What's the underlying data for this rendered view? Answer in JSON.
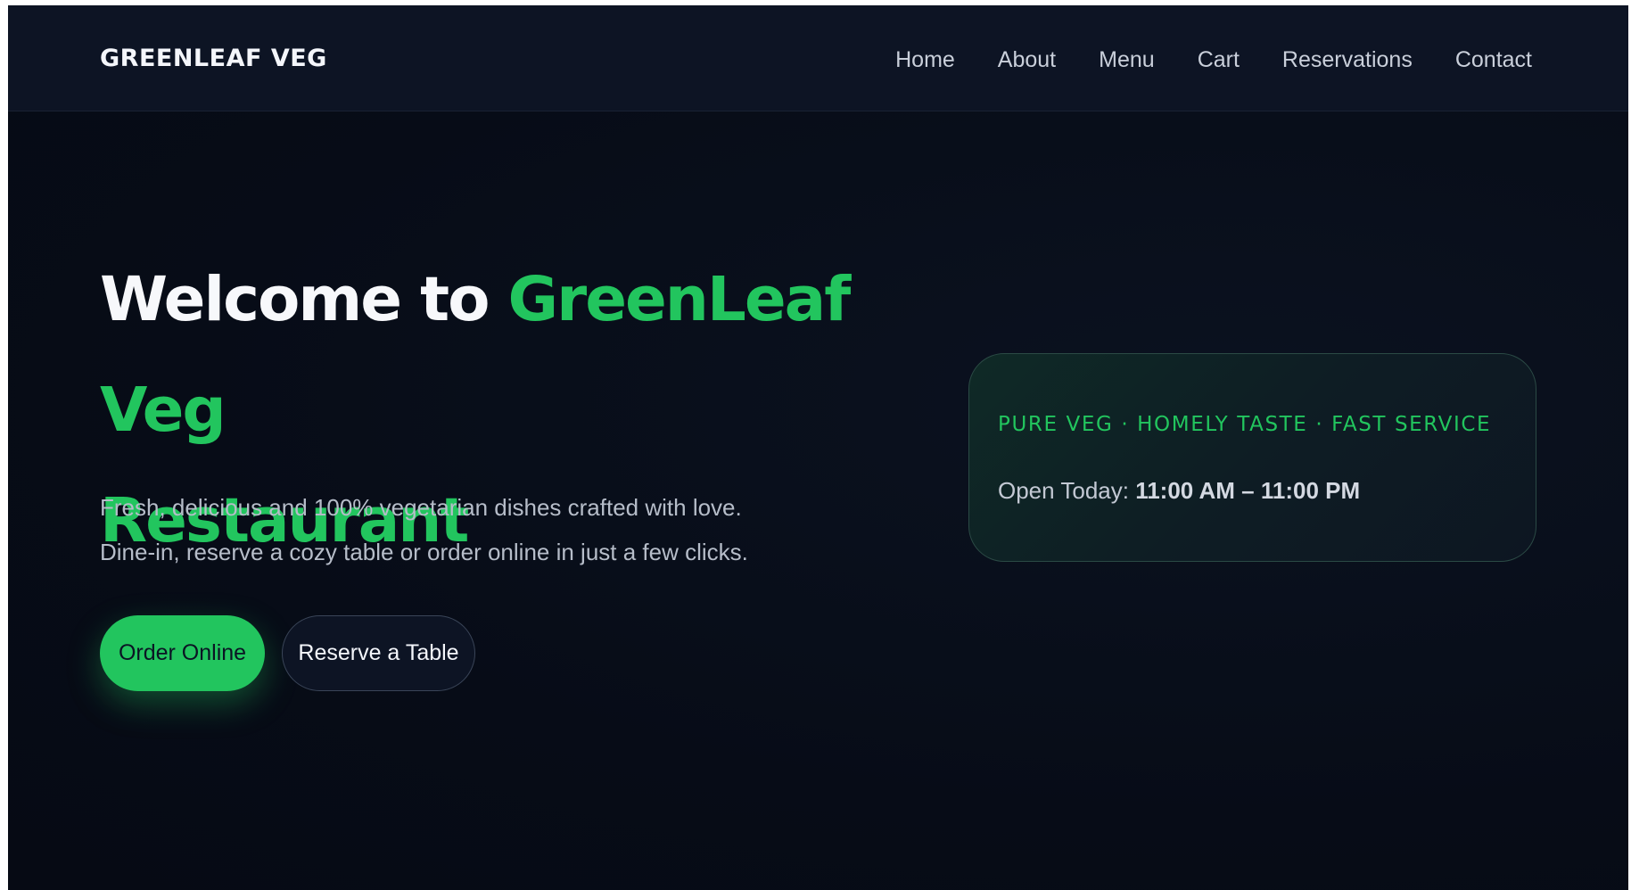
{
  "brand": {
    "name": "GREENLEAF VEG"
  },
  "nav": {
    "items": [
      {
        "label": "Home"
      },
      {
        "label": "About"
      },
      {
        "label": "Menu"
      },
      {
        "label": "Cart"
      },
      {
        "label": "Reservations"
      },
      {
        "label": "Contact"
      }
    ]
  },
  "hero": {
    "title_prefix": "Welcome to ",
    "title_accent_line1": "GreenLeaf Veg",
    "title_accent_line2": "Restaurant",
    "description_line1": "Fresh, delicious and 100% vegetarian dishes crafted with love.",
    "description_line2": "Dine-in, reserve a cozy table or order online in just a few clicks.",
    "primary_button": "Order Online",
    "secondary_button": "Reserve a Table"
  },
  "info_card": {
    "tagline": "PURE VEG · HOMELY TASTE · FAST SERVICE",
    "hours_label": "Open Today: ",
    "hours_value": "11:00 AM – 11:00 PM"
  },
  "colors": {
    "accent": "#22c55e",
    "background": "#070c17",
    "navbar": "#0d1424",
    "text_primary": "#f7f8fb",
    "text_muted": "#b6bdc9"
  }
}
